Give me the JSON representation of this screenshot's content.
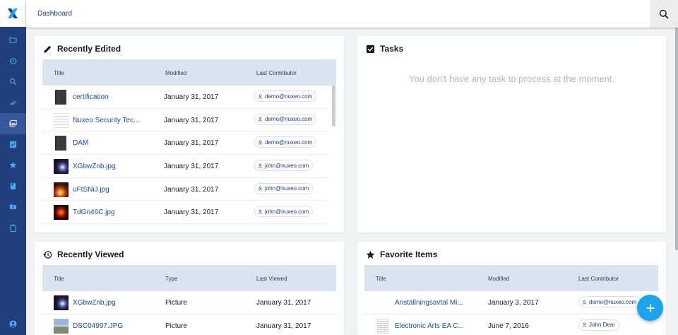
{
  "header": {
    "title": "Dashboard"
  },
  "sidebar": {
    "items": [
      {
        "icon": "folder-icon",
        "active": false
      },
      {
        "icon": "history-icon",
        "active": false
      },
      {
        "icon": "search-icon",
        "active": false
      },
      {
        "icon": "double-check-icon",
        "active": false
      },
      {
        "icon": "gallery-icon",
        "active": true
      },
      {
        "icon": "checkbox-icon",
        "active": false
      },
      {
        "icon": "star-icon",
        "active": false
      },
      {
        "icon": "book-icon",
        "active": false
      },
      {
        "icon": "shared-folder-icon",
        "active": false
      },
      {
        "icon": "clipboard-icon",
        "active": false
      }
    ],
    "user_icon": "account-circle-icon"
  },
  "recently_edited": {
    "title": "Recently Edited",
    "columns": [
      "Title",
      "Modified",
      "Last Contributor"
    ],
    "rows": [
      {
        "name": "certification",
        "modified": "January 31, 2017",
        "contributor": "demo@nuxeo.com",
        "thumb": "book"
      },
      {
        "name": "Nuxeo Security Tec...",
        "modified": "January 31, 2017",
        "contributor": "demo@nuxeo.com",
        "thumb": "doc"
      },
      {
        "name": "DAM",
        "modified": "January 31, 2017",
        "contributor": "demo@nuxeo.com",
        "thumb": "book"
      },
      {
        "name": "XGbwZnb.jpg",
        "modified": "January 31, 2017",
        "contributor": "john@nuxeo.com",
        "thumb": "space"
      },
      {
        "name": "uFtSNiJ.jpg",
        "modified": "January 31, 2017",
        "contributor": "john@nuxeo.com",
        "thumb": "fire"
      },
      {
        "name": "TdGn46C.jpg",
        "modified": "January 31, 2017",
        "contributor": "john@nuxeo.com",
        "thumb": "red"
      }
    ]
  },
  "tasks": {
    "title": "Tasks",
    "empty_message": "You don't have any task to process at the moment."
  },
  "recently_viewed": {
    "title": "Recently Viewed",
    "columns": [
      "Title",
      "Type",
      "Last Viewed"
    ],
    "rows": [
      {
        "name": "XGbwZnb.jpg",
        "type": "Picture",
        "viewed": "January 31, 2017",
        "thumb": "space"
      },
      {
        "name": "DSC04997.JPG",
        "type": "Picture",
        "viewed": "January 31, 2017",
        "thumb": "landscape"
      }
    ]
  },
  "favorite_items": {
    "title": "Favorite Items",
    "columns": [
      "Title",
      "Modified",
      "Last Contributor"
    ],
    "rows": [
      {
        "name": "Anställningsavtal Mi...",
        "modified": "January 3, 2017",
        "contributor": "demo@nuxeo.com",
        "thumb": "blank"
      },
      {
        "name": "Electronic Arts EA C...",
        "modified": "June 7, 2016",
        "contributor": "John Dear",
        "thumb": "page"
      }
    ]
  },
  "colors": {
    "sidebar": "#213f7d",
    "accent": "#1ca3ee",
    "link": "#1d4ea1",
    "table_header": "#dae3ee"
  }
}
